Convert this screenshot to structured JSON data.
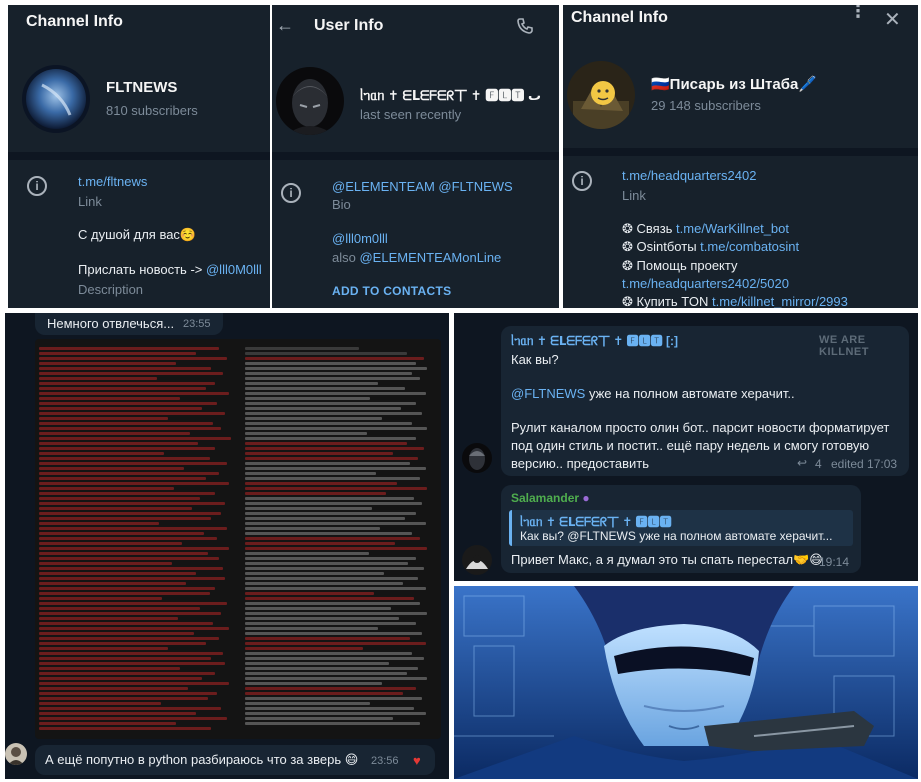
{
  "channel1": {
    "header_title": "Channel Info",
    "name": "FLTNEWS",
    "subscribers": "810 subscribers",
    "link": "t.me/fltnews",
    "link_label": "Link",
    "desc_line1": "С душой для вас☺️",
    "desc_line2_prefix": "Прислать новость -> ",
    "desc_line2_link": "@lll0M0lll",
    "desc_label": "Description"
  },
  "user": {
    "header_title": "User Info",
    "name": "ᥣᥐᥲᥒ ✝ ᗴᒪᗴᖴᗴᖇ丅 ✝ 🅵🅻🆃 ٮ",
    "status": "last seen recently",
    "bio_links": "@ELEMENTEAM @FLTNEWS",
    "bio_label": "Bio",
    "username": "@lll0m0lll",
    "also_prefix": "also ",
    "also_link": "@ELEMENTEAMonLine",
    "add_contacts": "ADD TO CONTACTS"
  },
  "channel2": {
    "header_title": "Channel Info",
    "name": "🇷🇺Писарь из Штаба🖊️",
    "subscribers": "29 148 subscribers",
    "link": "t.me/headquarters2402",
    "link_label": "Link",
    "l1_prefix": "❂ Связь ",
    "l1_link": "t.me/WarKillnet_bot",
    "l2_prefix": "❂ Osintботы ",
    "l2_link": "t.me/combatosint",
    "l3": "❂ Помощь проекту",
    "l3_link": "t.me/headquarters2402/5020",
    "l4_prefix": "❂ Купить TON ",
    "l4_link": "t.me/killnet_mirror/2993"
  },
  "terminal_chat": {
    "top_message": "Немного отвлечься...",
    "top_time": "23:55",
    "bottom_message": "А ещё попутно в python разбираюсь что за зверь 😄",
    "bottom_time": "23:56"
  },
  "chat": {
    "sender": "ᥣᥐᥲᥒ ✝ ᗴᒪᗴᖴᗴᖇ丅 ✝ 🅵🅻🆃 [:]",
    "watermark": "WE ARE KILLNET",
    "msg_line1": "Как вы?",
    "msg_mention": "@FLTNEWS",
    "msg_line2_rest": " уже на полном автомате херачит..",
    "msg_line3": "Рулит каналом просто олин бот.. парсит новости форматирует",
    "msg_line4": "под один стиль и постит.. ещё пару недель и смогу готовую",
    "msg_line5": "версию.. предоставить",
    "reply_count": "4",
    "edited_time": "edited 17:03",
    "reply_sender": "Salamander",
    "quote_author": "ᥣᥐᥲᥒ ✝ ᗴᒪᗴᖴᗴᖇ丅 ✝ 🅵🅻🆃",
    "quote_text": "Как вы?   @FLTNEWS уже на полном автомате херачит...",
    "reply_text": "Привет Макс, а я думал это ты спать перестал🤝😄",
    "reply_time": "19:14"
  },
  "colors": {
    "panel_bg": "#17212b",
    "link": "#6ab2f2",
    "salamander_name": "#4fae4e",
    "terminal_red": "#6b1d1d"
  }
}
